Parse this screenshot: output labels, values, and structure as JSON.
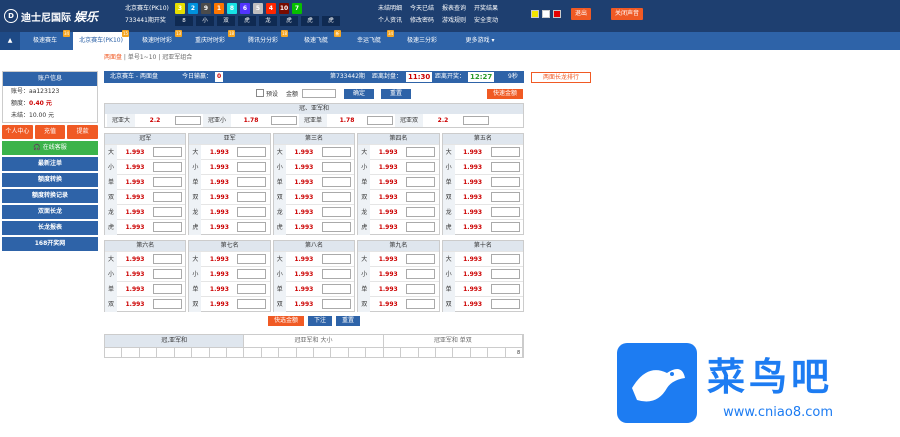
{
  "header": {
    "logo": "迪士尼国际",
    "logo_script": "娱乐",
    "game": "北京赛车(PK10)",
    "draw": "733441期开奖",
    "balls": [
      "3",
      "2",
      "9",
      "1",
      "8",
      "6",
      "5",
      "4",
      "10",
      "7"
    ],
    "ball_colors": [
      "#e6de00",
      "#0092dd",
      "#4b4b4b",
      "#ff7600",
      "#17e2e5",
      "#5234ff",
      "#bfbfbf",
      "#ff2600",
      "#780b00",
      "#07bf00"
    ],
    "tags": [
      "8",
      "小",
      "双",
      "虎",
      "龙",
      "虎",
      "虎",
      "虎"
    ],
    "links": [
      "未结明细",
      "今天已结",
      "报表查询",
      "开奖结果",
      "个人资讯",
      "修改密码",
      "游戏规则",
      "安全变动"
    ],
    "swatches": [
      "#f2e600",
      "#fff",
      "#e60000"
    ],
    "logout": "退出",
    "close_sound": "关闭声音"
  },
  "nav": {
    "items": [
      "极速赛车",
      "北京赛车(PK10)",
      "极速时时彩",
      "重庆时时彩",
      "腾讯分分彩",
      "极速飞艇",
      "幸运飞艇",
      "极速三分彩",
      "更多游戏"
    ],
    "badges": [
      "34",
      "15",
      "13",
      "18",
      "18",
      "新",
      "34",
      "",
      ""
    ]
  },
  "subnav": {
    "items": [
      "两面盘",
      "单号1~10",
      "冠亚军组合"
    ]
  },
  "account": {
    "title": "账户信息",
    "account_label": "账号：",
    "account": "aa123123",
    "credit_label": "额度：",
    "credit": "0.40 元",
    "unsettled_label": "未结：",
    "unsettled": "10.00 元",
    "btns": [
      "个人中心",
      "充值",
      "提款"
    ],
    "service": "在线客服",
    "menu": [
      "最新注单",
      "额度转换",
      "额度转换记录",
      "双面长龙",
      "长龙报表",
      "168开奖网"
    ]
  },
  "main": {
    "game_title": "北京赛车 - 两面盘",
    "today_label": "今日输赢：",
    "today_value": "0",
    "draw_label": "第733442期",
    "close_label": "距离封盘：",
    "close_time": "11:30",
    "open_label": "距离开奖：",
    "open_time": "12:27",
    "secs": "9秒",
    "longdragon": "两面长龙排行",
    "preset": "预设",
    "amount": "金额",
    "confirm": "确定",
    "reset": "重置",
    "quick": "快速金额",
    "sum_title": "冠、亚军和",
    "sum_items": [
      {
        "k": "冠亚大",
        "o": "2.2"
      },
      {
        "k": "冠亚小",
        "o": "1.78"
      },
      {
        "k": "冠亚单",
        "o": "1.78"
      },
      {
        "k": "冠亚双",
        "o": "2.2"
      }
    ],
    "cols1": [
      "冠军",
      "亚军",
      "第三名",
      "第四名",
      "第五名"
    ],
    "cols2": [
      "第六名",
      "第七名",
      "第八名",
      "第九名",
      "第十名"
    ],
    "keys1": [
      "大",
      "小",
      "单",
      "双",
      "龙",
      "虎"
    ],
    "keys2": [
      "大",
      "小",
      "单",
      "双"
    ],
    "odd": "1.993",
    "actions": [
      "快选金额",
      "下注",
      "重置"
    ],
    "result_headers": [
      "冠,亚军和",
      "冠亚军和 大小",
      "冠亚军和 单双"
    ],
    "result_end": "8"
  },
  "watermark": {
    "text": "菜鸟吧",
    "url": "www.cniao8.com"
  }
}
